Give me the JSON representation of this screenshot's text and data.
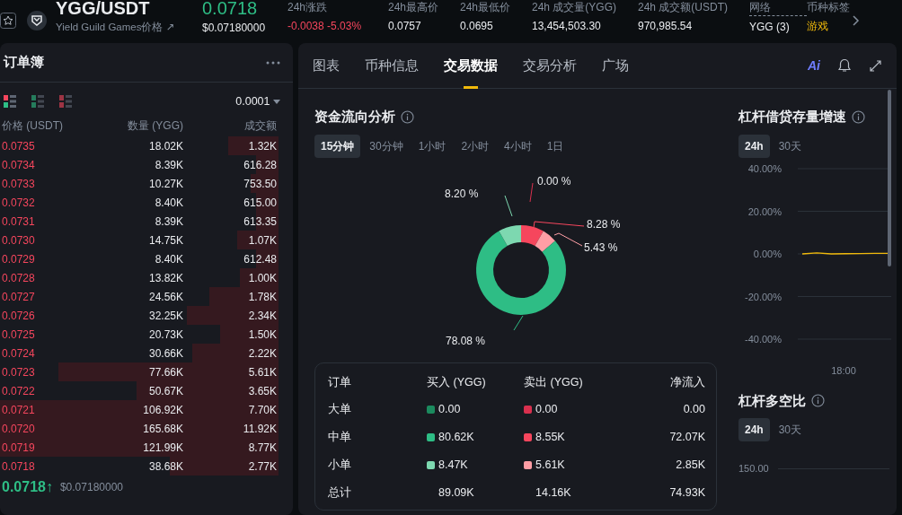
{
  "ticker": {
    "pair": "YGG/USDT",
    "name_link": "Yield Guild Games价格 ↗",
    "price": "0.0718",
    "price_usd": "$0.07180000",
    "stats": [
      {
        "label": "24h涨跌",
        "kind": "change",
        "value": "-0.0038 -5.03%"
      },
      {
        "label": "24h最高价",
        "kind": "plain",
        "value": "0.0757"
      },
      {
        "label": "24h最低价",
        "kind": "plain",
        "value": "0.0695"
      },
      {
        "label": "24h 成交量(YGG)",
        "kind": "plain",
        "value": "13,454,503.30"
      },
      {
        "label": "24h 成交额(USDT)",
        "kind": "plain",
        "value": "970,985.54"
      },
      {
        "label": "网络",
        "kind": "network",
        "value": "YGG (3)"
      },
      {
        "label": "币种标签",
        "kind": "tag",
        "value": "游戏"
      }
    ]
  },
  "order_book": {
    "title": "订单簿",
    "precision": "0.0001",
    "view_modes": [
      {
        "kind": "both",
        "selected": true
      },
      {
        "kind": "bids",
        "selected": false
      },
      {
        "kind": "asks",
        "selected": false
      }
    ],
    "columns": [
      "价格 (USDT)",
      "数量 (YGG)",
      "成交额"
    ],
    "rows": [
      {
        "price": "0.0735",
        "amount": "18.02K",
        "total": "1.32K",
        "level": 0.18
      },
      {
        "price": "0.0734",
        "amount": "8.39K",
        "total": "616.28",
        "level": 0.08
      },
      {
        "price": "0.0733",
        "amount": "10.27K",
        "total": "753.50",
        "level": 0.1
      },
      {
        "price": "0.0732",
        "amount": "8.40K",
        "total": "615.00",
        "level": 0.08
      },
      {
        "price": "0.0731",
        "amount": "8.39K",
        "total": "613.35",
        "level": 0.08
      },
      {
        "price": "0.0730",
        "amount": "14.75K",
        "total": "1.07K",
        "level": 0.15
      },
      {
        "price": "0.0729",
        "amount": "8.40K",
        "total": "612.48",
        "level": 0.08
      },
      {
        "price": "0.0728",
        "amount": "13.82K",
        "total": "1.00K",
        "level": 0.14
      },
      {
        "price": "0.0727",
        "amount": "24.56K",
        "total": "1.78K",
        "level": 0.25
      },
      {
        "price": "0.0726",
        "amount": "32.25K",
        "total": "2.34K",
        "level": 0.33
      },
      {
        "price": "0.0725",
        "amount": "20.73K",
        "total": "1.50K",
        "level": 0.21
      },
      {
        "price": "0.0724",
        "amount": "30.66K",
        "total": "2.22K",
        "level": 0.31
      },
      {
        "price": "0.0723",
        "amount": "77.66K",
        "total": "5.61K",
        "level": 0.79
      },
      {
        "price": "0.0722",
        "amount": "50.67K",
        "total": "3.65K",
        "level": 0.51
      },
      {
        "price": "0.0721",
        "amount": "106.92K",
        "total": "7.70K",
        "level": 1
      },
      {
        "price": "0.0720",
        "amount": "165.68K",
        "total": "11.92K",
        "level": 1
      },
      {
        "price": "0.0719",
        "amount": "121.99K",
        "total": "8.77K",
        "level": 1
      },
      {
        "price": "0.0718",
        "amount": "38.68K",
        "total": "2.77K",
        "level": 0.39
      }
    ],
    "last_price": "0.0718↑",
    "last_price_usd": "$0.07180000"
  },
  "tabs": [
    {
      "label": "图表",
      "selected": false
    },
    {
      "label": "币种信息",
      "selected": false
    },
    {
      "label": "交易数据",
      "selected": true
    },
    {
      "label": "交易分析",
      "selected": false
    },
    {
      "label": "广场",
      "selected": false
    }
  ],
  "toolbar": {
    "ai_label": "Ai"
  },
  "fund_flow": {
    "title": "资金流向分析",
    "periods": [
      {
        "label": "15分钟",
        "selected": true
      },
      {
        "label": "30分钟",
        "selected": false
      },
      {
        "label": "1小时",
        "selected": false
      },
      {
        "label": "2小时",
        "selected": false
      },
      {
        "label": "4小时",
        "selected": false
      },
      {
        "label": "1日",
        "selected": false
      }
    ],
    "chart_data": {
      "type": "donut",
      "values": [
        0.0,
        8.28,
        5.43,
        78.08,
        8.2
      ],
      "colors": [
        "#d9304e",
        "#f6465d",
        "#ff9ea5",
        "#2ebd85",
        "#7dd8b0"
      ],
      "value_labels": [
        "0.00 %",
        "8.28 %",
        "5.43 %",
        "78.08 %",
        "8.20 %"
      ]
    },
    "table": {
      "columns": [
        "订单",
        "买入 (YGG)",
        "卖出 (YGG)",
        "净流入"
      ],
      "rows": [
        {
          "label": "大单",
          "buy": {
            "value": "0.00",
            "color": "#1b8a5e"
          },
          "sell": {
            "value": "0.00",
            "color": "#d9304e"
          },
          "net": "0.00"
        },
        {
          "label": "中单",
          "buy": {
            "value": "80.62K",
            "color": "#2ebd85"
          },
          "sell": {
            "value": "8.55K",
            "color": "#f6465d"
          },
          "net": "72.07K"
        },
        {
          "label": "小单",
          "buy": {
            "value": "8.47K",
            "color": "#7dd8b0"
          },
          "sell": {
            "value": "5.61K",
            "color": "#ff9ea5"
          },
          "net": "2.85K"
        },
        {
          "label": "总计",
          "buy": {
            "value": "89.09K"
          },
          "sell": {
            "value": "14.16K"
          },
          "net": "74.93K"
        }
      ]
    }
  },
  "margin_growth": {
    "title": "杠杆借贷存量增速",
    "periods": [
      {
        "label": "24h",
        "selected": true
      },
      {
        "label": "30天",
        "selected": false
      }
    ],
    "chart_data": {
      "type": "line",
      "grid": true,
      "ylim": [
        -40,
        40
      ],
      "yticks": [
        {
          "value": 40,
          "label": "40.00%"
        },
        {
          "value": 20,
          "label": "20.00%"
        },
        {
          "value": 0,
          "label": "0.00%"
        },
        {
          "value": -20,
          "label": "-20.00%"
        },
        {
          "value": -40,
          "label": "-40.00%"
        }
      ],
      "series": [
        {
          "color": "#f0b90b",
          "values": [
            0,
            0.5,
            0,
            0.1,
            0.2,
            0.3,
            0.3
          ]
        }
      ]
    },
    "time_label": "18:00"
  },
  "long_short": {
    "title": "杠杆多空比",
    "periods": [
      {
        "label": "24h",
        "selected": true
      },
      {
        "label": "30天",
        "selected": false
      }
    ],
    "axis_label": "150.00"
  }
}
